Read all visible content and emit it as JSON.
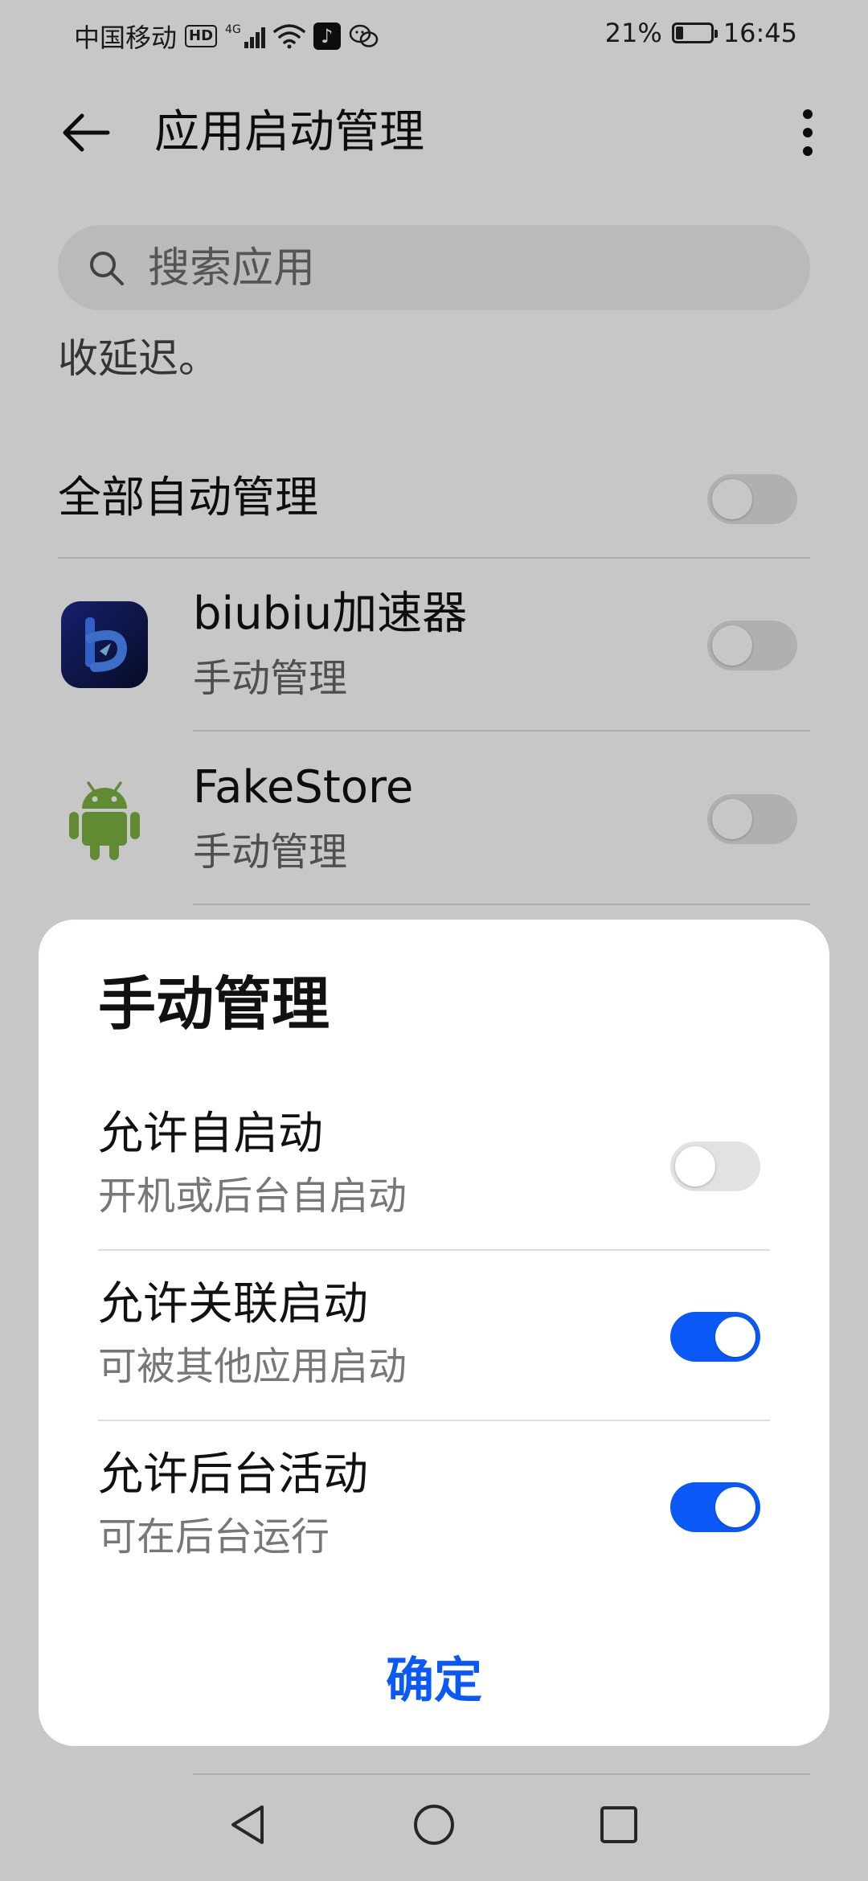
{
  "status_bar": {
    "carrier": "中国移动",
    "hd_badge": "HD",
    "network_type": "4G",
    "battery_percent": "21%",
    "battery_level": 0.21,
    "time": "16:45"
  },
  "app_bar": {
    "title": "应用启动管理"
  },
  "search": {
    "placeholder": "搜索应用"
  },
  "description_tail": "收延迟。",
  "list": {
    "all_auto_label": "全部自动管理",
    "all_auto_enabled": false,
    "apps": [
      {
        "name": "biubiu加速器",
        "status": "手动管理",
        "icon": "biubiu-app-icon",
        "enabled": false
      },
      {
        "name": "FakeStore",
        "status": "手动管理",
        "icon": "android-robot-icon",
        "enabled": false
      }
    ]
  },
  "dialog": {
    "title": "手动管理",
    "options": [
      {
        "title": "允许自启动",
        "subtitle": "开机或后台自启动",
        "enabled": false
      },
      {
        "title": "允许关联启动",
        "subtitle": "可被其他应用启动",
        "enabled": true
      },
      {
        "title": "允许后台活动",
        "subtitle": "可在后台运行",
        "enabled": true
      }
    ],
    "confirm_label": "确定"
  },
  "colors": {
    "accent": "#0a59f7",
    "toggle_off": "#e2e2e2",
    "scrim": "rgba(0,0,0,0.22)"
  },
  "icons": {
    "back": "arrow-left-icon",
    "more": "more-vertical-icon",
    "search": "search-icon",
    "nav_back": "triangle-back-icon",
    "nav_home": "circle-home-icon",
    "nav_recents": "square-recents-icon"
  }
}
